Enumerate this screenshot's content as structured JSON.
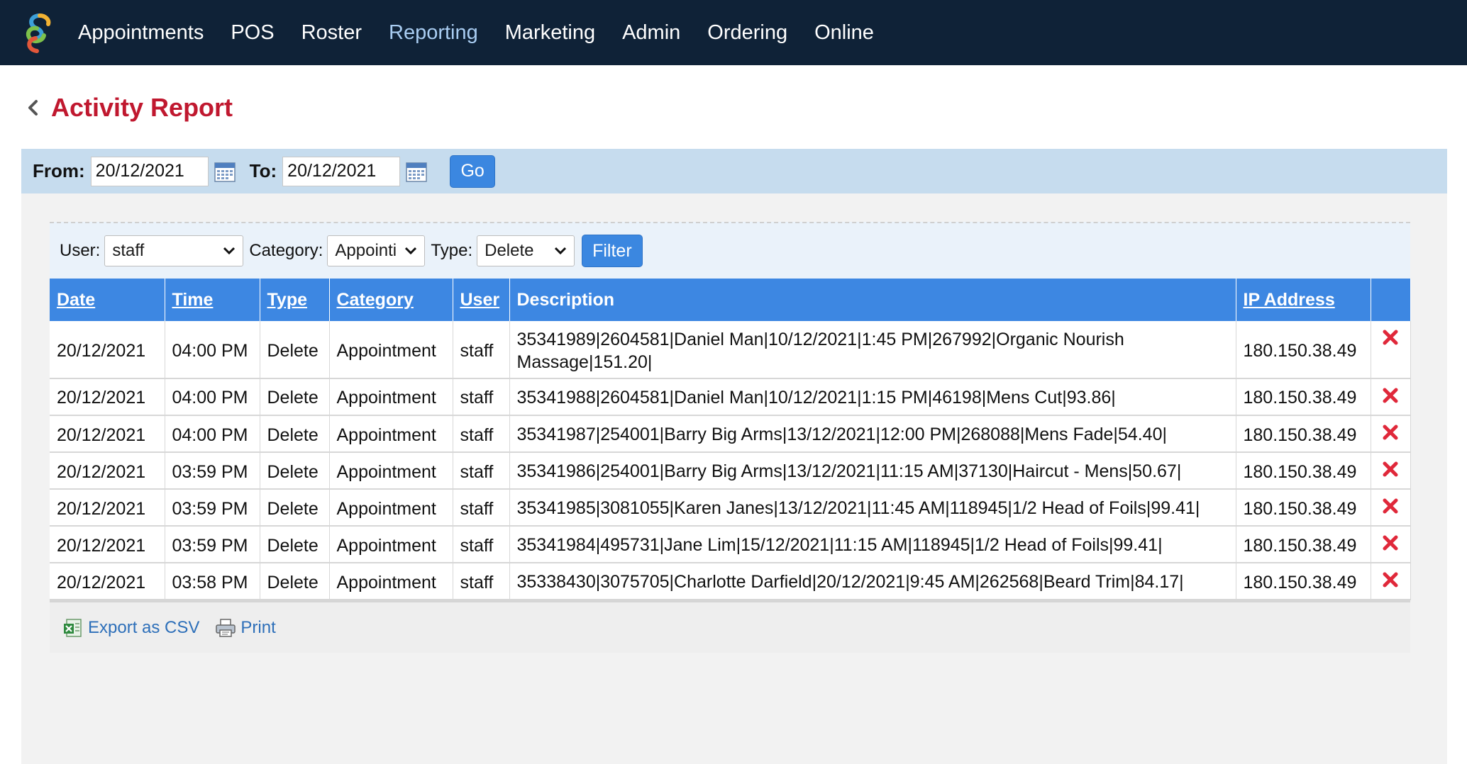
{
  "nav": {
    "items": [
      {
        "label": "Appointments",
        "active": false
      },
      {
        "label": "POS",
        "active": false
      },
      {
        "label": "Roster",
        "active": false
      },
      {
        "label": "Reporting",
        "active": true
      },
      {
        "label": "Marketing",
        "active": false
      },
      {
        "label": "Admin",
        "active": false
      },
      {
        "label": "Ordering",
        "active": false
      },
      {
        "label": "Online",
        "active": false
      }
    ]
  },
  "page": {
    "title": "Activity Report"
  },
  "date_filter": {
    "from_label": "From:",
    "from_value": "20/12/2021",
    "to_label": "To:",
    "to_value": "20/12/2021",
    "go_label": "Go"
  },
  "filters": {
    "user_label": "User:",
    "user_value": "staff",
    "category_label": "Category:",
    "category_value": "Appointi",
    "type_label": "Type:",
    "type_value": "Delete",
    "filter_label": "Filter"
  },
  "table": {
    "headers": {
      "date": "Date",
      "time": "Time",
      "type": "Type",
      "category": "Category",
      "user": "User",
      "description": "Description",
      "ip": "IP Address"
    },
    "rows": [
      {
        "date": "20/12/2021",
        "time": "04:00 PM",
        "type": "Delete",
        "category": "Appointment",
        "user": "staff",
        "description": "35341989|2604581|Daniel Man|10/12/2021|1:45 PM|267992|Organic Nourish Massage|151.20|",
        "ip": "180.150.38.49"
      },
      {
        "date": "20/12/2021",
        "time": "04:00 PM",
        "type": "Delete",
        "category": "Appointment",
        "user": "staff",
        "description": "35341988|2604581|Daniel Man|10/12/2021|1:15 PM|46198|Mens Cut|93.86|",
        "ip": "180.150.38.49"
      },
      {
        "date": "20/12/2021",
        "time": "04:00 PM",
        "type": "Delete",
        "category": "Appointment",
        "user": "staff",
        "description": "35341987|254001|Barry Big Arms|13/12/2021|12:00 PM|268088|Mens Fade|54.40|",
        "ip": "180.150.38.49"
      },
      {
        "date": "20/12/2021",
        "time": "03:59 PM",
        "type": "Delete",
        "category": "Appointment",
        "user": "staff",
        "description": "35341986|254001|Barry Big Arms|13/12/2021|11:15 AM|37130|Haircut - Mens|50.67|",
        "ip": "180.150.38.49"
      },
      {
        "date": "20/12/2021",
        "time": "03:59 PM",
        "type": "Delete",
        "category": "Appointment",
        "user": "staff",
        "description": "35341985|3081055|Karen Janes|13/12/2021|11:45 AM|118945|1/2 Head of Foils|99.41|",
        "ip": "180.150.38.49"
      },
      {
        "date": "20/12/2021",
        "time": "03:59 PM",
        "type": "Delete",
        "category": "Appointment",
        "user": "staff",
        "description": "35341984|495731|Jane Lim|15/12/2021|11:15 AM|118945|1/2 Head of Foils|99.41|",
        "ip": "180.150.38.49"
      },
      {
        "date": "20/12/2021",
        "time": "03:58 PM",
        "type": "Delete",
        "category": "Appointment",
        "user": "staff",
        "description": "35338430|3075705|Charlotte Darfield|20/12/2021|9:45 AM|262568|Beard Trim|84.17|",
        "ip": "180.150.38.49"
      }
    ]
  },
  "footer": {
    "export_label": "Export as CSV",
    "print_label": "Print"
  },
  "colors": {
    "nav_bg": "#0f2237",
    "nav_active": "#a9cdf2",
    "title_red": "#c0182f",
    "header_blue": "#3d87e2",
    "button_blue": "#3b87e0",
    "date_bar": "#c6dcee",
    "delete_red": "#e0283a"
  },
  "icons": {
    "logo": "brand-swirl-logo",
    "back": "chevron-left-icon",
    "calendar": "calendar-icon",
    "dropdown": "chevron-down-icon",
    "delete": "close-icon",
    "export": "excel-icon",
    "print": "printer-icon"
  }
}
